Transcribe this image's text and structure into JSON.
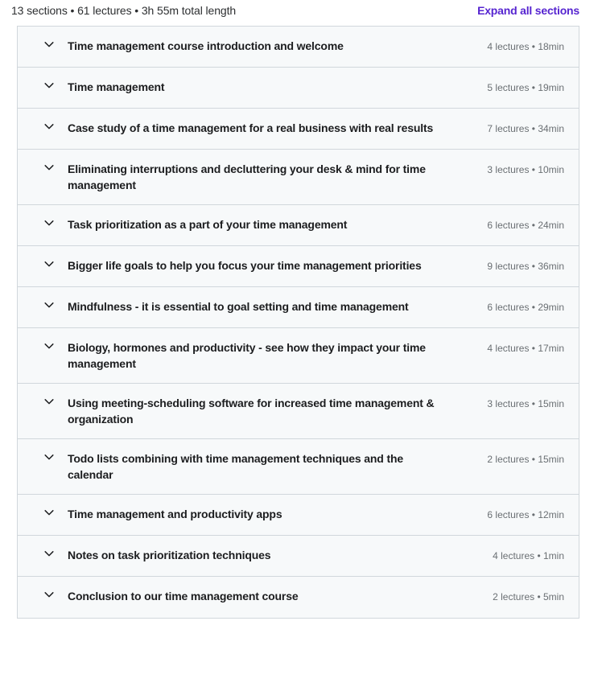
{
  "summary": {
    "meta_text": "13 sections • 61 lectures • 3h 55m total length",
    "expand_all_label": "Expand all sections",
    "accent_color": "#5624d0",
    "meta_color": "#2d2f31",
    "section_meta_color": "#6a6f73",
    "card_background": "#f7f9fa",
    "card_border": "#d1d7dc"
  },
  "chevron_icon": "chevron-down-icon",
  "sections": [
    {
      "title": "Time management course introduction and welcome",
      "meta": "4 lectures • 18min",
      "lectures": 4,
      "duration": "18min"
    },
    {
      "title": "Time management",
      "meta": "5 lectures • 19min",
      "lectures": 5,
      "duration": "19min"
    },
    {
      "title": "Case study of a time management for a real business with real results",
      "meta": "7 lectures • 34min",
      "lectures": 7,
      "duration": "34min"
    },
    {
      "title": "Eliminating interruptions and decluttering your desk & mind for time management",
      "meta": "3 lectures • 10min",
      "lectures": 3,
      "duration": "10min"
    },
    {
      "title": "Task prioritization as a part of your time management",
      "meta": "6 lectures • 24min",
      "lectures": 6,
      "duration": "24min"
    },
    {
      "title": "Bigger life goals to help you focus your time management priorities",
      "meta": "9 lectures • 36min",
      "lectures": 9,
      "duration": "36min"
    },
    {
      "title": "Mindfulness - it is essential to goal setting and time management",
      "meta": "6 lectures • 29min",
      "lectures": 6,
      "duration": "29min"
    },
    {
      "title": "Biology, hormones and productivity - see how they impact your time management",
      "meta": "4 lectures • 17min",
      "lectures": 4,
      "duration": "17min"
    },
    {
      "title": "Using meeting-scheduling software for increased time management & organization",
      "meta": "3 lectures • 15min",
      "lectures": 3,
      "duration": "15min"
    },
    {
      "title": "Todo lists combining with time management techniques and the calendar",
      "meta": "2 lectures • 15min",
      "lectures": 2,
      "duration": "15min"
    },
    {
      "title": "Time management and productivity apps",
      "meta": "6 lectures • 12min",
      "lectures": 6,
      "duration": "12min"
    },
    {
      "title": "Notes on task prioritization techniques",
      "meta": "4 lectures • 1min",
      "lectures": 4,
      "duration": "1min"
    },
    {
      "title": "Conclusion to our time management course",
      "meta": "2 lectures • 5min",
      "lectures": 2,
      "duration": "5min"
    }
  ]
}
